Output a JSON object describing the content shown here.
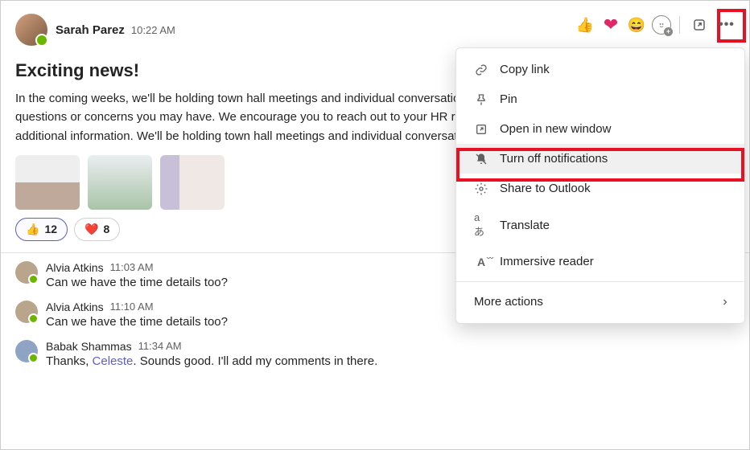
{
  "main": {
    "author": "Sarah Parez",
    "time": "10:22 AM",
    "title": "Exciting news!",
    "body": "In the coming weeks, we'll be holding town hall meetings and individual conversations to discuss this more in detail and answer any questions or concerns you may have. We encourage you to reach out to your HR representative if you have any questions or require additional information. We'll be holding town hall meetings and individual conversations to discuss this more in detail."
  },
  "pills": {
    "thumbs": {
      "emoji": "👍",
      "count": "12"
    },
    "heart": {
      "emoji": "❤️",
      "count": "8"
    }
  },
  "replies": [
    {
      "author": "Alvia Atkins",
      "time": "11:03 AM",
      "body": "Can we have the time details too?"
    },
    {
      "author": "Alvia Atkins",
      "time": "11:10 AM",
      "body": "Can we have the time details too?"
    },
    {
      "author": "Babak Shammas",
      "time": "11:34 AM",
      "body_pre": "Thanks, ",
      "link": "Celeste",
      "body_post": ". Sounds good. I'll add my comments in there."
    }
  ],
  "menu": {
    "copy_link": "Copy link",
    "pin": "Pin",
    "open_new": "Open in new window",
    "turn_off": "Turn off notifications",
    "share_outlook": "Share to Outlook",
    "translate": "Translate",
    "immersive": "Immersive reader",
    "more": "More actions"
  },
  "header_emojis": {
    "thumbs": "👍",
    "heart": "❤",
    "laugh": "😄"
  }
}
